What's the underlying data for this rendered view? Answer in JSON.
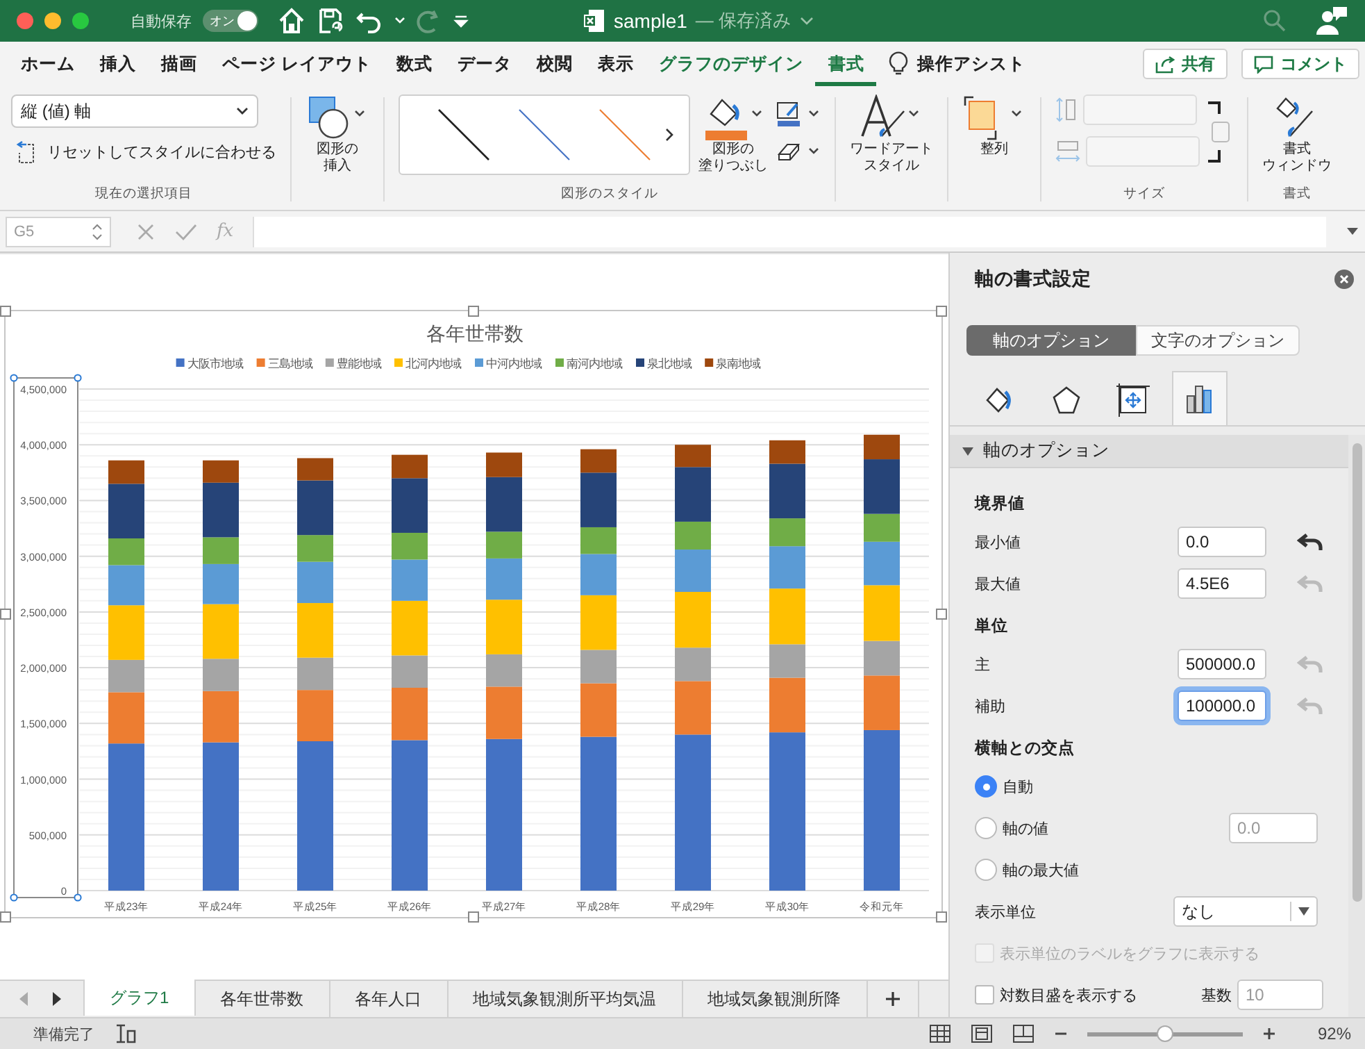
{
  "window": {
    "autosave_label": "自動保存",
    "autosave_toggle": {
      "label": "オン",
      "on": true
    },
    "title": "sample1",
    "save_status": "— 保存済み"
  },
  "ribbon_tabs": [
    {
      "label": "ホーム",
      "selected": false,
      "kind": "normal"
    },
    {
      "label": "挿入",
      "selected": false,
      "kind": "normal"
    },
    {
      "label": "描画",
      "selected": false,
      "kind": "normal"
    },
    {
      "label": "ページ レイアウト",
      "selected": false,
      "kind": "normal"
    },
    {
      "label": "数式",
      "selected": false,
      "kind": "normal"
    },
    {
      "label": "データ",
      "selected": false,
      "kind": "normal"
    },
    {
      "label": "校閲",
      "selected": false,
      "kind": "normal"
    },
    {
      "label": "表示",
      "selected": false,
      "kind": "normal"
    },
    {
      "label": "グラフのデザイン",
      "selected": false,
      "kind": "contextual"
    },
    {
      "label": "書式",
      "selected": true,
      "kind": "contextual"
    },
    {
      "label": "操作アシスト",
      "selected": false,
      "kind": "assist"
    }
  ],
  "share_button": "共有",
  "comment_button": "コメント",
  "ribbon": {
    "selection_dropdown": "縦 (値) 軸",
    "reset_button": "リセットしてスタイルに合わせる",
    "current_selection_label": "現在の選択項目",
    "insert_shape_button": [
      "図形の",
      "挿入"
    ],
    "shape_styles_label": "図形のスタイル",
    "shape_fill_button": [
      "図形の",
      "塗りつぶし"
    ],
    "wordart_button": [
      "ワードアート",
      "スタイル"
    ],
    "arrange_button": [
      "整列"
    ],
    "size_label": "サイズ",
    "format_pane_button": [
      "書式",
      "ウィンドウ"
    ],
    "format_label": "書式"
  },
  "formula_bar": {
    "name_box": "G5",
    "function_button": "fx"
  },
  "chart": {
    "chart_data": {
      "type": "bar",
      "title": "各年世帯数",
      "stacked": true,
      "orientation": "vertical",
      "grid": true,
      "legend": true,
      "categories": [
        "平成23年",
        "平成24年",
        "平成25年",
        "平成26年",
        "平成27年",
        "平成28年",
        "平成29年",
        "平成30年",
        "令和元年"
      ],
      "series": [
        {
          "name": "大阪市地域",
          "color": "#4472c4",
          "values": [
            1320000,
            1330000,
            1340000,
            1350000,
            1360000,
            1380000,
            1400000,
            1420000,
            1440000
          ]
        },
        {
          "name": "三島地域",
          "color": "#ed7d31",
          "values": [
            460000,
            460000,
            460000,
            470000,
            470000,
            480000,
            480000,
            490000,
            490000
          ]
        },
        {
          "name": "豊能地域",
          "color": "#a5a5a5",
          "values": [
            290000,
            290000,
            290000,
            290000,
            290000,
            300000,
            300000,
            300000,
            310000
          ]
        },
        {
          "name": "北河内地域",
          "color": "#ffc000",
          "values": [
            490000,
            490000,
            490000,
            490000,
            490000,
            490000,
            500000,
            500000,
            500000
          ]
        },
        {
          "name": "中河内地域",
          "color": "#5b9bd5",
          "values": [
            360000,
            360000,
            370000,
            370000,
            370000,
            370000,
            380000,
            380000,
            390000
          ]
        },
        {
          "name": "南河内地域",
          "color": "#70ad47",
          "values": [
            240000,
            240000,
            240000,
            240000,
            240000,
            240000,
            250000,
            250000,
            250000
          ]
        },
        {
          "name": "泉北地域",
          "color": "#264478",
          "values": [
            490000,
            490000,
            490000,
            490000,
            490000,
            490000,
            490000,
            490000,
            490000
          ]
        },
        {
          "name": "泉南地域",
          "color": "#9e480e",
          "values": [
            210000,
            200000,
            200000,
            210000,
            220000,
            210000,
            200000,
            210000,
            220000
          ]
        }
      ],
      "ylim": [
        0,
        4500000
      ],
      "yticks": [
        {
          "value": 0,
          "label": "0"
        },
        {
          "value": 500000,
          "label": "500,000"
        },
        {
          "value": 1000000,
          "label": "1,000,000"
        },
        {
          "value": 1500000,
          "label": "1,500,000"
        },
        {
          "value": 2000000,
          "label": "2,000,000"
        },
        {
          "value": 2500000,
          "label": "2,500,000"
        },
        {
          "value": 3000000,
          "label": "3,000,000"
        },
        {
          "value": 3500000,
          "label": "3,500,000"
        },
        {
          "value": 4000000,
          "label": "4,000,000"
        },
        {
          "value": 4500000,
          "label": "4,500,000"
        }
      ]
    }
  },
  "format_panel": {
    "title": "軸の書式設定",
    "tabs": [
      {
        "label": "軸のオプション",
        "selected": true
      },
      {
        "label": "文字のオプション",
        "selected": false
      }
    ],
    "icon_tabs": [
      {
        "kind": "fill",
        "selected": false
      },
      {
        "kind": "shape",
        "selected": false
      },
      {
        "kind": "size",
        "selected": false
      },
      {
        "kind": "axis",
        "selected": true
      }
    ],
    "section": {
      "label": "軸のオプション",
      "expanded": true
    },
    "groups": [
      {
        "heading": "境界値",
        "fields": [
          {
            "label": "最小値",
            "value": "0.0",
            "reset_enabled": true,
            "focused": false
          },
          {
            "label": "最大値",
            "value": "4.5E6",
            "reset_enabled": false,
            "focused": false
          }
        ]
      },
      {
        "heading": "単位",
        "fields": [
          {
            "label": "主",
            "value": "500000.0",
            "reset_enabled": false,
            "focused": false
          },
          {
            "label": "補助",
            "value": "100000.0",
            "reset_enabled": false,
            "focused": true
          }
        ]
      }
    ],
    "crossing": {
      "heading": "横軸との交点",
      "options": [
        {
          "label": "自動",
          "selected": true
        },
        {
          "label": "軸の値",
          "selected": false,
          "value": "0.0"
        },
        {
          "label": "軸の最大値",
          "selected": false
        }
      ]
    },
    "display_unit": {
      "label": "表示単位",
      "value": "なし"
    },
    "unit_label_checkbox": {
      "label": "表示単位のラベルをグラフに表示する",
      "checked": false,
      "disabled": true
    },
    "log_scale": {
      "label": "対数目盛を表示する",
      "checked": false,
      "base_label": "基数",
      "base_value": "10"
    }
  },
  "sheet_tabs": [
    {
      "label": "グラフ1",
      "selected": true
    },
    {
      "label": "各年世帯数",
      "selected": false
    },
    {
      "label": "各年人口",
      "selected": false
    },
    {
      "label": "地域気象観測所平均気温",
      "selected": false
    },
    {
      "label": "地域気象観測所降",
      "selected": false
    }
  ],
  "status_bar": {
    "text": "準備完了",
    "zoom": "92%",
    "zoom_slider": {
      "level": 0.45
    }
  }
}
